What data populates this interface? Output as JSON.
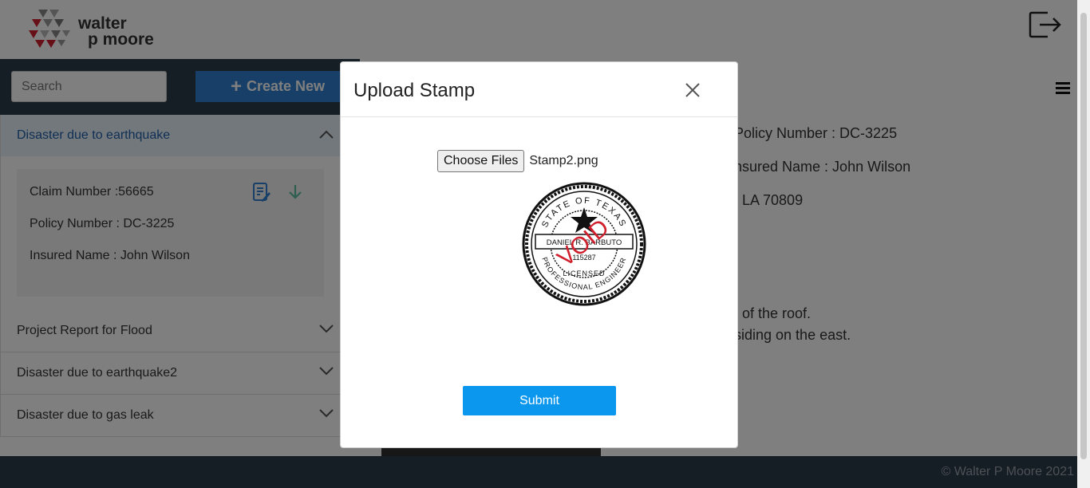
{
  "brand": {
    "logo_line1": "walter",
    "logo_line2": "p moore"
  },
  "sidebar": {
    "search_placeholder": "Search",
    "create_label": "Create New",
    "accordion": [
      {
        "title": "Disaster due to earthquake",
        "expanded": true,
        "card": {
          "claim": "Claim Number :56665",
          "policy": "Policy Number : DC-3225",
          "insured": "Insured Name : John Wilson"
        }
      },
      {
        "title": "Project Report for Flood",
        "expanded": false
      },
      {
        "title": "Disaster due to earthquake2",
        "expanded": false
      },
      {
        "title": "Disaster due to gas leak",
        "expanded": false
      }
    ]
  },
  "content": {
    "policy": "Policy Number : DC-3225",
    "insured": "nsured Name : John Wilson",
    "address": ", LA 70809",
    "line1": "of the roof.",
    "line2": "siding on the east."
  },
  "modal": {
    "title": "Upload Stamp",
    "choose_label": "Choose Files",
    "file_name": "Stamp2.png",
    "submit_label": "Submit",
    "stamp": {
      "top_text": "STATE OF TEXAS",
      "bottom_text": "PROFESSIONAL ENGINEER",
      "name": "DANIEL R. BARBUTO",
      "number": "115287",
      "licensed": "LICENSED",
      "void": "VOID"
    }
  },
  "footer": {
    "text": "© Walter P Moore 2021"
  },
  "colors": {
    "navy": "#2b3a4a",
    "primary": "#2e7fd1",
    "submit": "#0b97ee",
    "brand_red": "#d0202e"
  }
}
